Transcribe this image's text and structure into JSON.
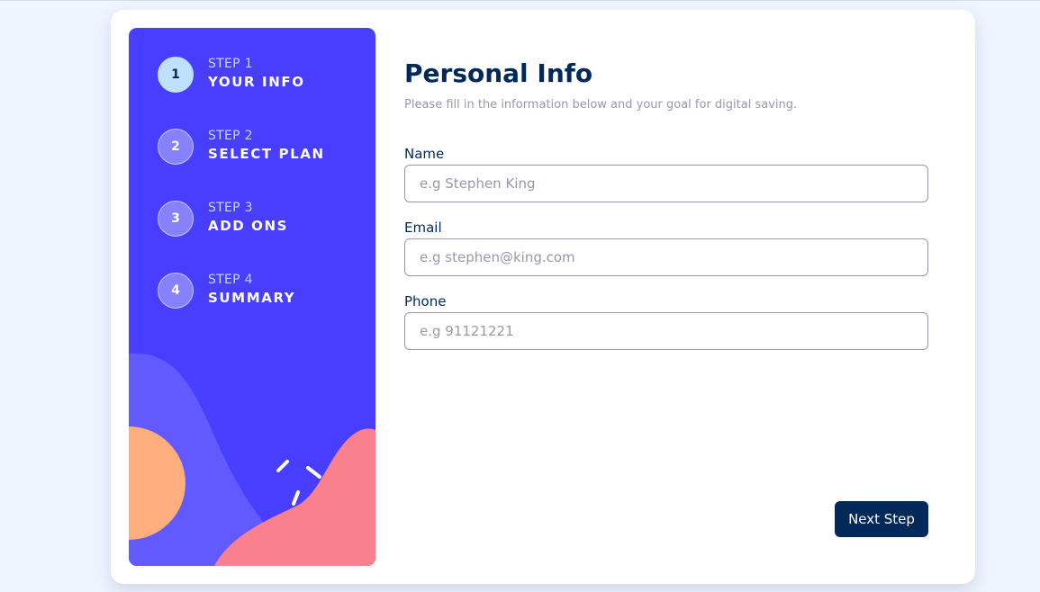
{
  "colors": {
    "page_background": "#eff5ff",
    "sidebar": "#483eff",
    "active_step": "#bee2fd",
    "primary_text": "#02295a",
    "muted_text": "#9699ab",
    "button": "#02295a"
  },
  "sidebar": {
    "steps": [
      {
        "number": "1",
        "step_label": "STEP 1",
        "name": "YOUR INFO",
        "active": true
      },
      {
        "number": "2",
        "step_label": "STEP 2",
        "name": "SELECT PLAN",
        "active": false
      },
      {
        "number": "3",
        "step_label": "STEP 3",
        "name": "ADD ONS",
        "active": false
      },
      {
        "number": "4",
        "step_label": "STEP 4",
        "name": "SUMMARY",
        "active": false
      }
    ]
  },
  "main": {
    "title": "Personal Info",
    "subtitle": "Please fill in the information below and your goal for digital saving.",
    "fields": [
      {
        "label": "Name",
        "value": "",
        "placeholder": "e.g Stephen King"
      },
      {
        "label": "Email",
        "value": "",
        "placeholder": "e.g stephen@king.com"
      },
      {
        "label": "Phone",
        "value": "",
        "placeholder": "e.g 91121221"
      }
    ],
    "next_label": "Next Step"
  }
}
